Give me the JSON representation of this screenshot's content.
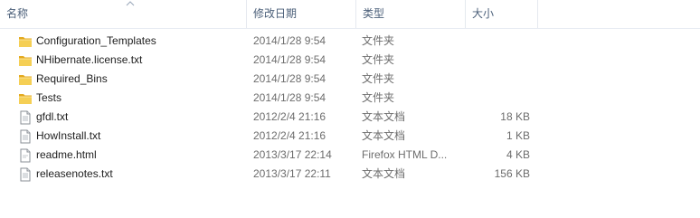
{
  "columns": {
    "name": "名称",
    "date": "修改日期",
    "type": "类型",
    "size": "大小"
  },
  "files": [
    {
      "name": "Configuration_Templates",
      "date": "2014/1/28 9:54",
      "type": "文件夹",
      "size": "",
      "icon": "folder-icon"
    },
    {
      "name": "NHibernate.license.txt",
      "date": "2014/1/28 9:54",
      "type": "文件夹",
      "size": "",
      "icon": "folder-icon"
    },
    {
      "name": "Required_Bins",
      "date": "2014/1/28 9:54",
      "type": "文件夹",
      "size": "",
      "icon": "folder-icon"
    },
    {
      "name": "Tests",
      "date": "2014/1/28 9:54",
      "type": "文件夹",
      "size": "",
      "icon": "folder-icon"
    },
    {
      "name": "gfdl.txt",
      "date": "2012/2/4 21:16",
      "type": "文本文档",
      "size": "18 KB",
      "icon": "text-file-icon"
    },
    {
      "name": "HowInstall.txt",
      "date": "2012/2/4 21:16",
      "type": "文本文档",
      "size": "1 KB",
      "icon": "text-file-icon"
    },
    {
      "name": "readme.html",
      "date": "2013/3/17 22:14",
      "type": "Firefox HTML D...",
      "size": "4 KB",
      "icon": "html-file-icon"
    },
    {
      "name": "releasenotes.txt",
      "date": "2013/3/17 22:11",
      "type": "文本文档",
      "size": "156 KB",
      "icon": "text-file-icon"
    }
  ],
  "colors": {
    "folder": "#e8b83a",
    "header_text": "#4c607a",
    "detail_text": "#6d6d6d"
  }
}
